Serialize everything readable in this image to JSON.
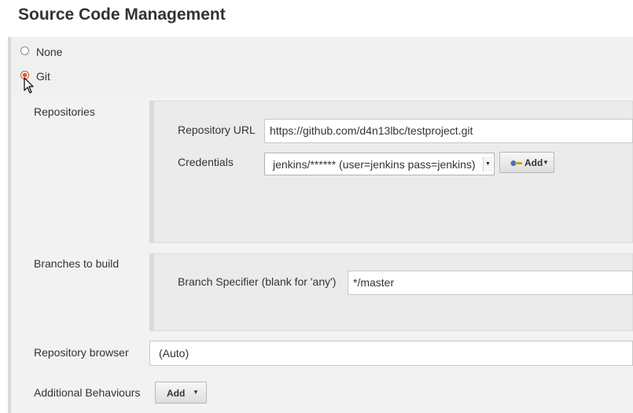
{
  "section": {
    "title": "Source Code Management"
  },
  "scm_options": [
    {
      "label": "None",
      "selected": false
    },
    {
      "label": "Git",
      "selected": true
    }
  ],
  "repositories": {
    "label": "Repositories",
    "url_label": "Repository URL",
    "url_value": "https://github.com/d4n13lbc/testproject.git",
    "credentials_label": "Credentials",
    "credentials_value": "jenkins/****** (user=jenkins pass=jenkins)",
    "add_button": "Add"
  },
  "branches": {
    "label": "Branches to build",
    "specifier_label": "Branch Specifier (blank for 'any')",
    "specifier_value": "*/master"
  },
  "repository_browser": {
    "label": "Repository browser",
    "value": "(Auto)"
  },
  "additional_behaviours": {
    "label": "Additional Behaviours",
    "add_button": "Add"
  },
  "colors": {
    "radio_selected": "#e0592a",
    "panel_bg": "#ebebeb",
    "section_bg": "#f0f0f0"
  }
}
